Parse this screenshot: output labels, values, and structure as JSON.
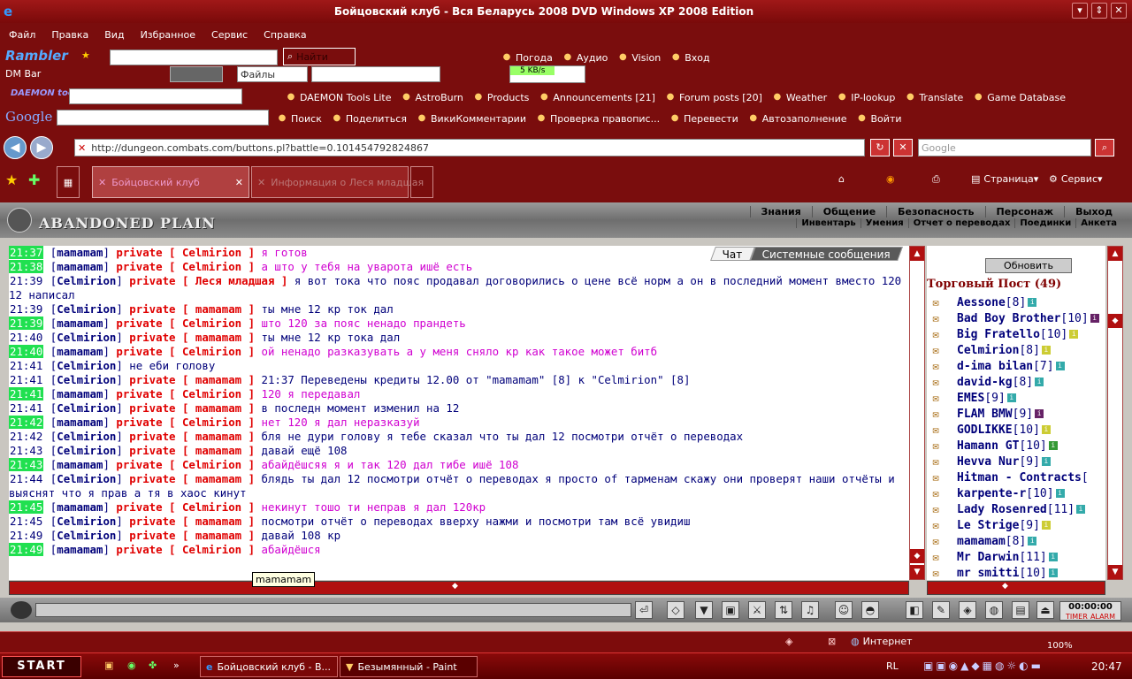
{
  "window": {
    "title": "Бойцовский клуб - Вся Беларусь 2008 DVD Windows XP 2008 Edition"
  },
  "menubar": [
    "Файл",
    "Правка",
    "Вид",
    "Избранное",
    "Сервис",
    "Справка"
  ],
  "toolbar1": {
    "brand": "Rambler",
    "search_label": "Найти",
    "items": [
      "Погода",
      "Аудио",
      "Vision",
      "Вход"
    ]
  },
  "toolbar2": {
    "label": "DM Bar",
    "files": "Файлы",
    "speed": "5 KB/s"
  },
  "toolbar3": {
    "brand": "DAEMON tools",
    "items": [
      "DAEMON Tools Lite",
      "AstroBurn",
      "Products",
      "Announcements [21]",
      "Forum posts [20]",
      "Weather",
      "IP-lookup",
      "Translate",
      "Game Database"
    ]
  },
  "toolbar4": {
    "brand": "Google",
    "items": [
      "Поиск",
      "Поделиться",
      "ВикиКомментарии",
      "Проверка правопис...",
      "Перевести",
      "Автозаполнение",
      "Войти"
    ]
  },
  "address": {
    "url": "http://dungeon.combats.com/buttons.pl?battle=0.101454792824867",
    "search_placeholder": "Google"
  },
  "tabs": [
    {
      "label": "Бойцовский клуб"
    },
    {
      "label": "Информация о Леся младшая"
    }
  ],
  "ietools": {
    "page": "Страница",
    "service": "Сервис"
  },
  "game": {
    "logo": "ABANDONED PLAIN",
    "menu1": [
      "Знания",
      "Общение",
      "Безопасность",
      "Персонаж",
      "Выход"
    ],
    "menu2": [
      "Инвентарь",
      "Умения",
      "Отчет о переводах",
      "Поединки",
      "Анкета"
    ],
    "chat_tabs": [
      "Чат",
      "Системные сообщения"
    ],
    "chat": [
      {
        "time": "21:37",
        "green": true,
        "nick": "mamamam",
        "priv": "private [ Celmirion ]",
        "text": "я готов",
        "pink": true
      },
      {
        "time": "21:38",
        "green": true,
        "nick": "mamamam",
        "priv": "private [ Celmirion ]",
        "text": "а што у тебя на уварота ишё есть",
        "pink": true
      },
      {
        "time": "21:39",
        "green": false,
        "nick": "Celmirion",
        "priv": "private [ Леся младшая ]",
        "text": "я вот тока что пояс продавал договорились о цене всё норм а он в последний момент вместо 120 12 написал",
        "pink": false
      },
      {
        "time": "21:39",
        "green": false,
        "nick": "Celmirion",
        "priv": "private [ mamamam ]",
        "text": "ты мне 12 кр ток дал",
        "pink": false
      },
      {
        "time": "21:39",
        "green": true,
        "nick": "mamamam",
        "priv": "private [ Celmirion ]",
        "text": "што 120 за пояс ненадо прандеть",
        "pink": true
      },
      {
        "time": "21:40",
        "green": false,
        "nick": "Celmirion",
        "priv": "private [ mamamam ]",
        "text": "ты мне 12 кр тока дал",
        "pink": false
      },
      {
        "time": "21:40",
        "green": true,
        "nick": "mamamam",
        "priv": "private [ Celmirion ]",
        "text": "ой ненадо разказувать а у меня сняло кр как такое может битб",
        "pink": true
      },
      {
        "time": "21:41",
        "green": false,
        "nick": "Celmirion",
        "priv": "",
        "text": "не еби голову",
        "pink": false
      },
      {
        "time": "21:41",
        "green": false,
        "nick": "Celmirion",
        "priv": "private [ mamamam ]",
        "text": "21:37 Переведены кредиты 12.00 от \"mamamam\" [8] к \"Celmirion\" [8]",
        "pink": false
      },
      {
        "time": "21:41",
        "green": true,
        "nick": "mamamam",
        "priv": "private [ Celmirion ]",
        "text": "120 я передавал",
        "pink": true
      },
      {
        "time": "21:41",
        "green": false,
        "nick": "Celmirion",
        "priv": "private [ mamamam ]",
        "text": "в последн момент изменил на 12",
        "pink": false
      },
      {
        "time": "21:42",
        "green": true,
        "nick": "mamamam",
        "priv": "private [ Celmirion ]",
        "text": "нет 120 я дал неразказуй",
        "pink": true
      },
      {
        "time": "21:42",
        "green": false,
        "nick": "Celmirion",
        "priv": "private [ mamamam ]",
        "text": "бля не дури голову я тебе сказал что ты дал 12 посмотри отчёт о переводах",
        "pink": false
      },
      {
        "time": "21:43",
        "green": false,
        "nick": "Celmirion",
        "priv": "private [ mamamam ]",
        "text": "давай ещё 108",
        "pink": false
      },
      {
        "time": "21:43",
        "green": true,
        "nick": "mamamam",
        "priv": "private [ Celmirion ]",
        "text": "абайдёшсяя я и так 120 дал тибе ишё 108",
        "pink": true
      },
      {
        "time": "21:44",
        "green": false,
        "nick": "Celmirion",
        "priv": "private [ mamamam ]",
        "text": "блядь ты дал 12 посмотри отчёт о переводах я просто of тарменам скажу они проверят наши отчёты и выяснят что я прав а тя в хаос кинут",
        "pink": false
      },
      {
        "time": "21:45",
        "green": true,
        "nick": "mamamam",
        "priv": "private [ Celmirion ]",
        "text": "некинут тошо ти неправ я дал 120кр",
        "pink": true
      },
      {
        "time": "21:45",
        "green": false,
        "nick": "Celmirion",
        "priv": "private [ mamamam ]",
        "text": "посмотри отчёт о переводах вверху нажми и посмотри там всё увидиш",
        "pink": false
      },
      {
        "time": "21:49",
        "green": false,
        "nick": "Celmirion",
        "priv": "private [ mamamam ]",
        "text": "давай 108 кр",
        "pink": false
      },
      {
        "time": "21:49",
        "green": true,
        "nick": "mamamam",
        "priv": "private [ Celmirion ]",
        "text": "абайдёшся",
        "pink": true
      }
    ],
    "tooltip": "mamamam",
    "refresh": "Обновить",
    "post_title": "Торговый Пост (49)",
    "users": [
      {
        "name": "Aessonе",
        "lvl": "[8]",
        "info": "#3aa"
      },
      {
        "name": "Bad Boy Brother",
        "lvl": "[10]",
        "info": "#626"
      },
      {
        "name": "Big Fratello",
        "lvl": "[10]",
        "info": "#cc3"
      },
      {
        "name": "Celmirion",
        "lvl": "[8]",
        "info": "#cc3"
      },
      {
        "name": "d-ima bilan",
        "lvl": "[7]",
        "info": "#3aa"
      },
      {
        "name": "david-kg",
        "lvl": "[8]",
        "info": "#3aa"
      },
      {
        "name": "EMES",
        "lvl": "[9]",
        "info": "#3aa"
      },
      {
        "name": "FLAM BMW",
        "lvl": "[9]",
        "info": "#626"
      },
      {
        "name": "GODLIKKE",
        "lvl": "[10]",
        "info": "#cc3"
      },
      {
        "name": "Hamann GT",
        "lvl": "[10]",
        "info": "#393"
      },
      {
        "name": "Hevva Nur",
        "lvl": "[9]",
        "info": "#3aa"
      },
      {
        "name": "Hitman - Contracts",
        "lvl": "[",
        "info": ""
      },
      {
        "name": "karpente-r",
        "lvl": "[10]",
        "info": "#3aa"
      },
      {
        "name": "Lady Rosenred",
        "lvl": "[11]",
        "info": "#3aa"
      },
      {
        "name": "Le Strige",
        "lvl": "[9]",
        "info": "#cc3"
      },
      {
        "name": "mamamam",
        "lvl": "[8]",
        "info": "#3aa"
      },
      {
        "name": "Mr Darwin",
        "lvl": "[11]",
        "info": "#3aa"
      },
      {
        "name": "mr smitti",
        "lvl": "[10]",
        "info": "#3aa"
      }
    ],
    "timer": {
      "time": "00:00:00",
      "label1": "TIMER",
      "label2": "ALARM"
    }
  },
  "statusbar": {
    "zone": "Интернет",
    "zoom": "100%"
  },
  "taskbar": {
    "start": "START",
    "tasks": [
      "Бойцовский клуб - В...",
      "Безымянный - Paint"
    ],
    "lang": "RL",
    "clock": "20:47"
  }
}
